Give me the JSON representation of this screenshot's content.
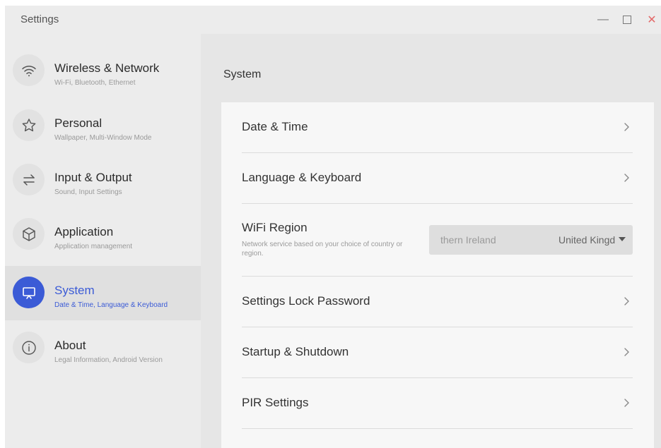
{
  "window": {
    "title": "Settings",
    "controls": {
      "minimize": "—",
      "close": "✕"
    }
  },
  "sidebar": {
    "items": [
      {
        "label": "Wireless & Network",
        "sub": "Wi-Fi, Bluetooth, Ethernet",
        "icon": "wifi-icon",
        "active": false
      },
      {
        "label": "Personal",
        "sub": "Wallpaper, Multi-Window Mode",
        "icon": "star-icon",
        "active": false
      },
      {
        "label": "Input & Output",
        "sub": "Sound, Input Settings",
        "icon": "swap-arrows-icon",
        "active": false
      },
      {
        "label": "Application",
        "sub": "Application management",
        "icon": "cube-icon",
        "active": false
      },
      {
        "label": "System",
        "sub": "Date & Time, Language & Keyboard",
        "icon": "monitor-icon",
        "active": true
      },
      {
        "label": "About",
        "sub": "Legal Information, Android Version",
        "icon": "info-icon",
        "active": false
      }
    ]
  },
  "main": {
    "section_title": "System",
    "rows": [
      {
        "label": "Date & Time"
      },
      {
        "label": "Language & Keyboard"
      },
      {
        "label": "WiFi Region",
        "desc": "Network service based on your choice of country or region.",
        "dropdown": {
          "faded_option": "thern Ireland",
          "value": "United Kingdom"
        }
      },
      {
        "label": "Settings Lock Password"
      },
      {
        "label": "Startup & Shutdown"
      },
      {
        "label": "PIR Settings"
      }
    ]
  },
  "colors": {
    "accent": "#3b5bd6",
    "window_bg": "#eeeeee",
    "content_bg": "#e6e6e6",
    "card_bg": "#f7f7f7",
    "close": "#e36a6a"
  }
}
